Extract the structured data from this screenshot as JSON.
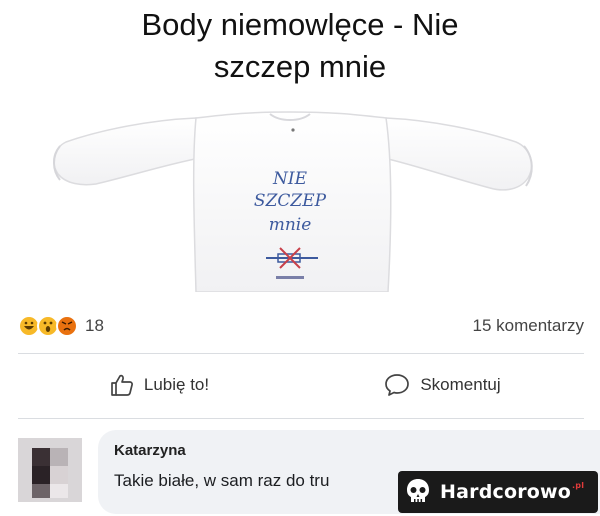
{
  "post": {
    "title_line1": "Body niemowlęce - Nie",
    "title_line2": "szczep mnie",
    "shirt_print": [
      "NIE",
      "SZCZEP",
      "mnie"
    ]
  },
  "reactions": {
    "icons": [
      "laugh-emoji-icon",
      "wow-emoji-icon",
      "angry-emoji-icon"
    ],
    "count": "18",
    "comments_count_label": "15 komentarzy"
  },
  "actions": {
    "like_label": "Lubię to!",
    "comment_label": "Skomentuj"
  },
  "comment": {
    "author": "Katarzyna",
    "text": "Takie białe, w sam raz do tru"
  },
  "watermark": {
    "brand": "Hardcorowo",
    "tld": ".pl"
  },
  "colors": {
    "laugh": "#f7b928",
    "angry": "#e9710f",
    "print_blue": "#3d5a9e"
  }
}
